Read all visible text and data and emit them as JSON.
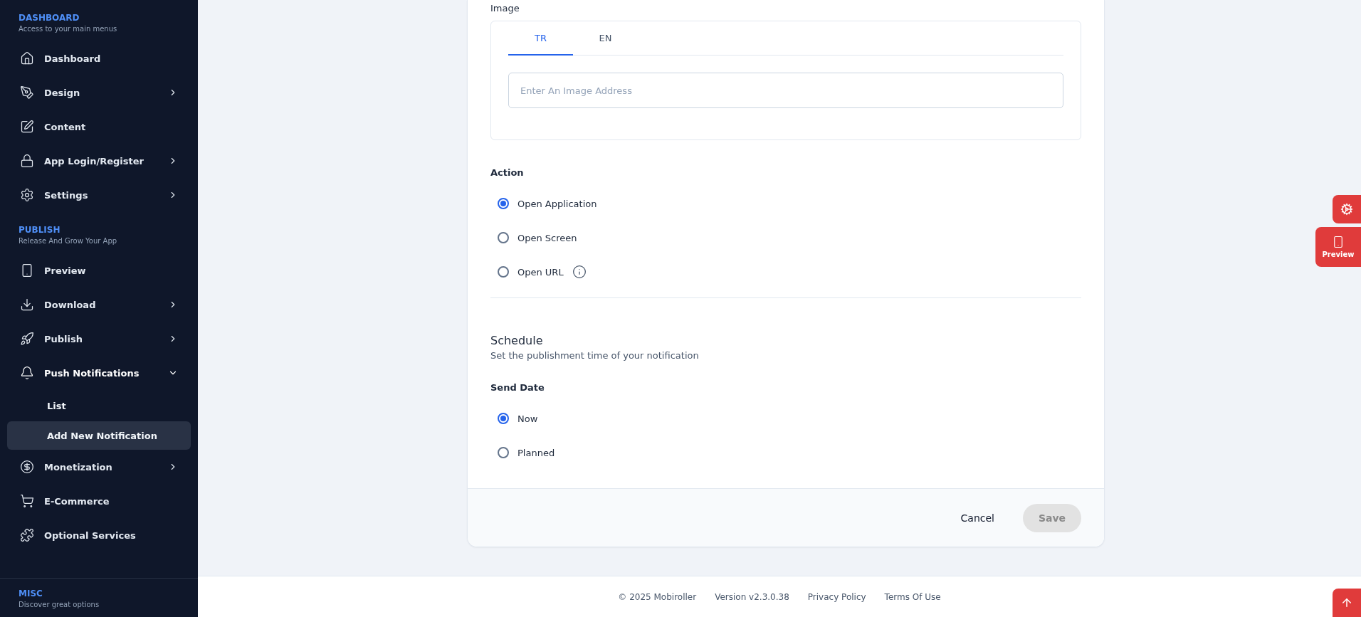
{
  "sidebar": {
    "sections": [
      {
        "title": "DASHBOARD",
        "subtitle": "Access to your main menus",
        "items": [
          {
            "label": "Dashboard"
          },
          {
            "label": "Design",
            "expanded": false
          },
          {
            "label": "Content"
          },
          {
            "label": "App Login/Register",
            "expanded": false
          },
          {
            "label": "Settings",
            "expanded": false
          }
        ]
      },
      {
        "title": "PUBLISH",
        "subtitle": "Release And Grow Your App",
        "items": [
          {
            "label": "Preview"
          },
          {
            "label": "Download",
            "expanded": false
          },
          {
            "label": "Publish",
            "expanded": false
          },
          {
            "label": "Push Notifications",
            "expanded": true,
            "children": [
              {
                "label": "List",
                "selected": false
              },
              {
                "label": "Add New Notification",
                "selected": true
              }
            ]
          },
          {
            "label": "Monetization",
            "expanded": false
          },
          {
            "label": "E-Commerce"
          },
          {
            "label": "Optional Services"
          }
        ]
      },
      {
        "title": "MISC",
        "subtitle": "Discover great options"
      }
    ]
  },
  "form": {
    "image": {
      "label": "Image",
      "tabs": [
        {
          "label": "TR",
          "selected": true
        },
        {
          "label": "EN",
          "selected": false
        }
      ],
      "placeholder": "Enter An Image Address"
    },
    "action": {
      "label": "Action",
      "options": [
        {
          "label": "Open Application",
          "selected": true
        },
        {
          "label": "Open Screen",
          "selected": false
        },
        {
          "label": "Open URL",
          "selected": false,
          "info": true
        }
      ]
    },
    "schedule": {
      "title": "Schedule",
      "subtitle": "Set the publishment time of your notification",
      "label": "Send Date",
      "options": [
        {
          "label": "Now",
          "selected": true
        },
        {
          "label": "Planned",
          "selected": false
        }
      ]
    },
    "buttons": {
      "cancel": "Cancel",
      "save": "Save",
      "save_disabled": true
    }
  },
  "floating": {
    "preview": "Preview"
  },
  "footer": [
    "© 2025 Mobiroller",
    "Version v2.3.0.38",
    "Privacy Policy",
    "Terms Of Use"
  ]
}
